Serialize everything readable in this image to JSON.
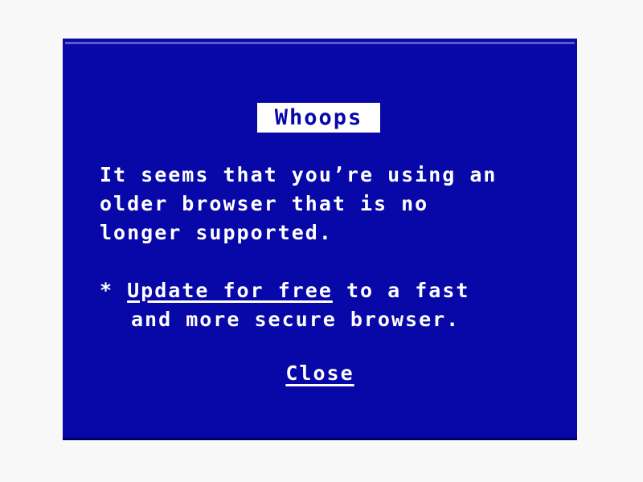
{
  "page": {
    "background_color": "#f8f8f8"
  },
  "dialog": {
    "background_color": "#0808a8",
    "highlight_color": "#5a5ac8",
    "shadow_color": "#000060",
    "text_color": "#ffffff",
    "title": {
      "label": "Whoops",
      "text_color": "#0808a8",
      "box_color": "#ffffff"
    },
    "message": {
      "lines": [
        "It seems that you’re using an",
        "older browser that is no",
        "longer supported."
      ]
    },
    "bullet": {
      "marker": "*",
      "link_label": "Update for free",
      "text_after": " to a fast",
      "line_two": "and more secure browser."
    },
    "close": {
      "label": "Close"
    }
  }
}
